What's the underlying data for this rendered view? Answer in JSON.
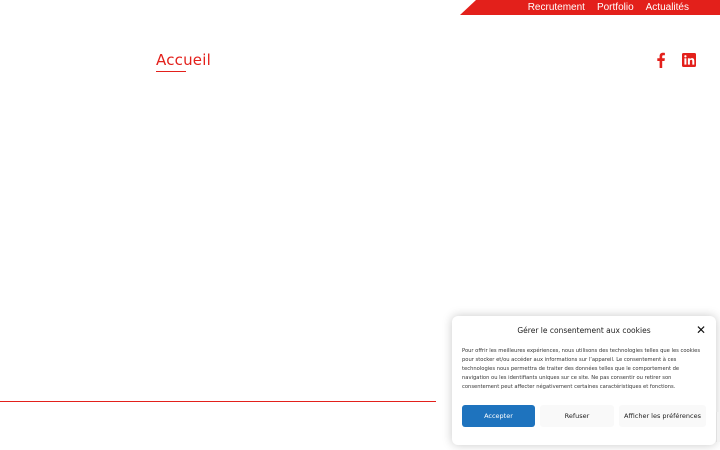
{
  "nav": {
    "items": [
      "Recrutement",
      "Portfolio",
      "Actualités"
    ]
  },
  "page": {
    "title": "Accueil"
  },
  "social": {
    "icons": [
      "facebook-icon",
      "linkedin-icon"
    ]
  },
  "cookie_banner": {
    "title": "Gérer le consentement aux cookies",
    "body": "Pour offrir les meilleures expériences, nous utilisons des technologies telles que les cookies pour stocker et/ou accéder aux informations sur l’appareil. Le consentement à ces technologies nous permettra de traiter des données telles que le comportement de navigation ou les identifiants uniques sur ce site. Ne pas consentir ou retirer son consentement peut affecter négativement certaines caractéristiques et fonctions.",
    "close_symbol": "✕",
    "accept_label": "Accepter",
    "refuse_label": "Refuser",
    "preferences_label": "Afficher les préférences"
  },
  "colors": {
    "brand_red": "#e3201b",
    "accept_blue": "#1e73be",
    "linkedin_red": "#e3201b"
  }
}
